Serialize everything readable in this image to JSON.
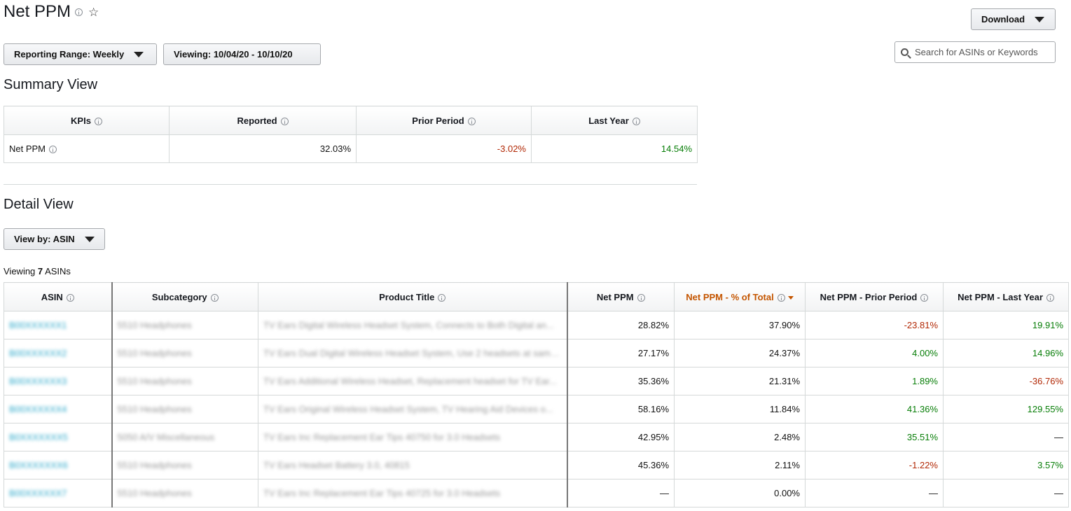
{
  "page": {
    "title": "Net PPM"
  },
  "header": {
    "download_label": "Download",
    "reporting_range_label": "Reporting Range: Weekly",
    "viewing_range_label": "Viewing: 10/04/20 - 10/10/20",
    "search_placeholder": "Search for ASINs or Keywords"
  },
  "summary": {
    "title": "Summary View",
    "columns": [
      "KPIs",
      "Reported",
      "Prior Period",
      "Last Year"
    ],
    "row": {
      "kpi": "Net PPM",
      "reported": "32.03%",
      "prior_period": "-3.02%",
      "last_year": "14.54%"
    }
  },
  "detail": {
    "title": "Detail View",
    "view_by_label": "View by: ASIN",
    "viewing_prefix": "Viewing",
    "viewing_count": "7",
    "viewing_suffix": "ASINs",
    "columns": [
      "ASIN",
      "Subcategory",
      "Product Title",
      "Net PPM",
      "Net PPM - % of Total",
      "Net PPM - Prior Period",
      "Net PPM - Last Year"
    ],
    "rows": [
      {
        "asin": "B00XXXXXX1",
        "subcategory": "5510 Headphones",
        "title": "TV Ears Digital Wireless Headset System, Connects to Both Digital an...",
        "net_ppm": "28.82%",
        "pct_total": "37.90%",
        "prior": "-23.81%",
        "last_year": "19.91%"
      },
      {
        "asin": "B00XXXXXX2",
        "subcategory": "5510 Headphones",
        "title": "TV Ears Dual Digital Wireless Headset System, Use 2 headsets at same...",
        "net_ppm": "27.17%",
        "pct_total": "24.37%",
        "prior": "4.00%",
        "last_year": "14.96%"
      },
      {
        "asin": "B00XXXXXX3",
        "subcategory": "5510 Headphones",
        "title": "TV Ears Additional Wireless Headset, Replacement headset for TV Ear...",
        "net_ppm": "35.36%",
        "pct_total": "21.31%",
        "prior": "1.89%",
        "last_year": "-36.76%"
      },
      {
        "asin": "B00XXXXXX4",
        "subcategory": "5510 Headphones",
        "title": "TV Ears Original Wireless Headset System, TV Hearing Aid Devices o...",
        "net_ppm": "58.16%",
        "pct_total": "11.84%",
        "prior": "41.36%",
        "last_year": "129.55%"
      },
      {
        "asin": "B0XXXXXXX5",
        "subcategory": "5050 A/V Miscellaneous",
        "title": "TV Ears Inc Replacement Ear Tips 40750 for 3.0 Headsets",
        "net_ppm": "42.95%",
        "pct_total": "2.48%",
        "prior": "35.51%",
        "last_year": "—"
      },
      {
        "asin": "B0XXXXXXX6",
        "subcategory": "5510 Headphones",
        "title": "TV Ears Headset Battery 3.0, 40815",
        "net_ppm": "45.36%",
        "pct_total": "2.11%",
        "prior": "-1.22%",
        "last_year": "3.57%"
      },
      {
        "asin": "B00XXXXXX7",
        "subcategory": "5510 Headphones",
        "title": "TV Ears Inc Replacement Ear Tips 40725 for 3.0 Headsets",
        "net_ppm": "—",
        "pct_total": "0.00%",
        "prior": "—",
        "last_year": "—"
      }
    ]
  },
  "colors": {
    "negative": "#b12704",
    "positive": "#067d06",
    "sorted_header": "#c45500",
    "link": "#2aa7c9"
  }
}
